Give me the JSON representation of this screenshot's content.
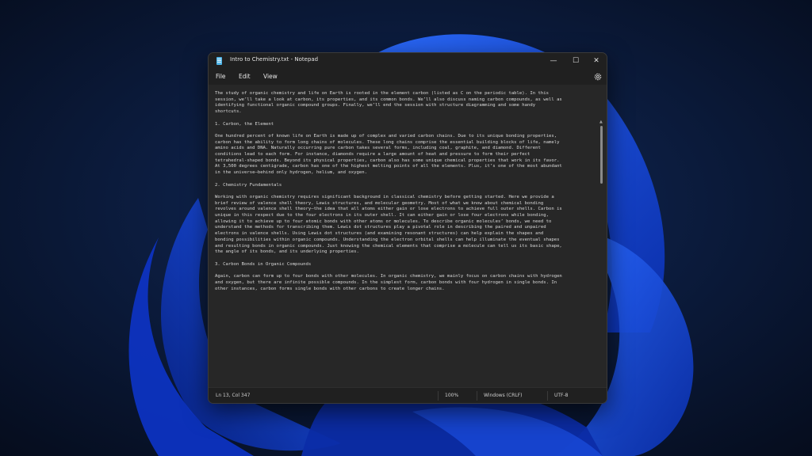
{
  "window": {
    "title": "Intro to Chemistry.txt - Notepad"
  },
  "controls": {
    "minimize": "—",
    "maximize": "☐",
    "close": "✕"
  },
  "menu": {
    "file": "File",
    "edit": "Edit",
    "view": "View"
  },
  "icons": [
    "notepad-app-icon",
    "settings-gear-icon"
  ],
  "document": {
    "text": "The study of organic chemistry and life on Earth is rooted in the element carbon (listed as C on the periodic table). In this\nsession, we’ll take a look at carbon, its properties, and its common bonds. We’ll also discuss naming carbon compounds, as well as\nidentifying functional organic compound groups. Finally, we’ll end the session with structure diagramming and some handy\nshortcuts.\n\n1. Carbon, the Element\n\nOne hundred percent of known life on Earth is made up of complex and varied carbon chains. Due to its unique bonding properties,\ncarbon has the ability to form long chains of molecules. These long chains comprise the essential building blocks of life, namely\namino acids and DNA. Naturally occurring pure carbon takes several forms, including coal, graphite, and diamond. Different\nconditions lead to each form. For instance, diamonds require a large amount of heat and pressure to form their perfect\ntetrahedral-shaped bonds. Beyond its physical properties, carbon also has some unique chemical properties that work in its favor.\nAt 3,500 degrees centigrade, carbon has one of the highest melting points of all the elements. Plus, it’s one of the most abundant\nin the universe—behind only hydrogen, helium, and oxygen.\n\n2. Chemistry Fundamentals\n\nWorking with organic chemistry requires significant background in classical chemistry before getting started. Here we provide a\nbrief review of valence shell theory, Lewis structures, and molecular geometry. Most of what we know about chemical bonding\nrevolves around valence shell theory—the idea that all atoms either gain or lose electrons to achieve full outer shells. Carbon is\nunique in this respect due to the four electrons in its outer shell. It can either gain or lose four electrons while bonding,\nallowing it to achieve up to four atomic bonds with other atoms or molecules. To describe organic molecules’ bonds, we need to\nunderstand the methods for transcribing them. Lewis dot structures play a pivotal role in describing the paired and unpaired\nelectrons in valence shells. Using Lewis dot structures (and examining resonant structures) can help explain the shapes and\nbonding possibilities within organic compounds. Understanding the electron orbital shells can help illuminate the eventual shapes\nand resulting bonds in organic compounds. Just knowing the chemical elements that comprise a molecule can tell us its basic shape,\nthe angle of its bonds, and its underlying properties.\n\n3. Carbon Bonds in Organic Compounds\n\nAgain, carbon can form up to four bonds with other molecules. In organic chemistry, we mainly focus on carbon chains with hydrogen\nand oxygen, but there are infinite possible compounds. In the simplest form, carbon bonds with four hydrogen in single bonds. In\nother instances, carbon forms single bonds with other carbons to create longer chains."
  },
  "statusbar": {
    "position": "Ln 13, Col 347",
    "zoom": "100%",
    "line_ending": "Windows (CRLF)",
    "encoding": "UTF-8"
  },
  "colors": {
    "editor_bg": "#272727",
    "chrome_bg": "#202020",
    "text": "#d8d8d8",
    "wallpaper_accent": "#1f5ef0"
  }
}
